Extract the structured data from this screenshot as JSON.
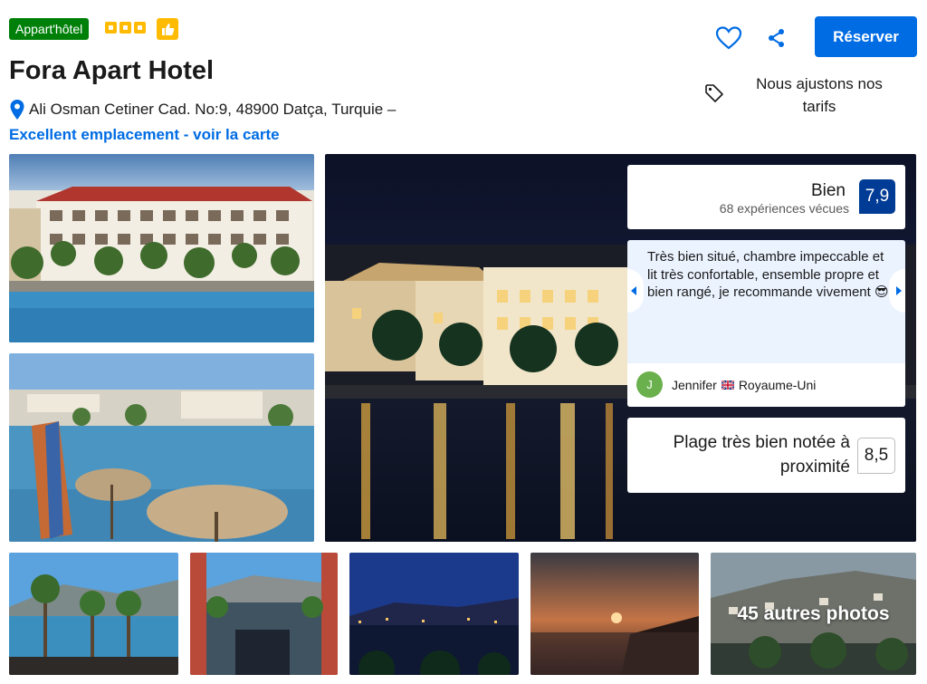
{
  "header": {
    "property_type": "Appart'hôtel",
    "stars": 3,
    "hotel_name": "Fora Apart Hotel",
    "address": "Ali Osman Cetiner Cad. No:9, 48900 Datça, Turquie –",
    "map_link": "Excellent emplacement - voir la carte",
    "reserve_label": "Réserver",
    "price_note": "Nous ajustons nos tarifs"
  },
  "rating": {
    "word": "Bien",
    "count": "68 expériences vécues",
    "score": "7,9"
  },
  "review": {
    "text": "Très bien situé, chambre impeccable et lit très confortable, ensemble propre et bien rangé, je recommande vivement 😎",
    "avatar_letter": "J",
    "reviewer_name": "Jennifer",
    "reviewer_country": "Royaume-Uni"
  },
  "beach": {
    "label": "Plage très bien notée à proximité",
    "score": "8,5"
  },
  "gallery": {
    "more_photos": "45 autres photos"
  },
  "colors": {
    "brand_blue": "#006ce4",
    "score_navy": "#003b95",
    "badge_green": "#008009",
    "star_yellow": "#febb02"
  },
  "icons": [
    "map-pin-icon",
    "heart-icon",
    "share-icon",
    "price-tag-icon",
    "thumbs-up-icon",
    "star-icon",
    "chevron-left-icon",
    "chevron-right-icon",
    "uk-flag-icon"
  ]
}
